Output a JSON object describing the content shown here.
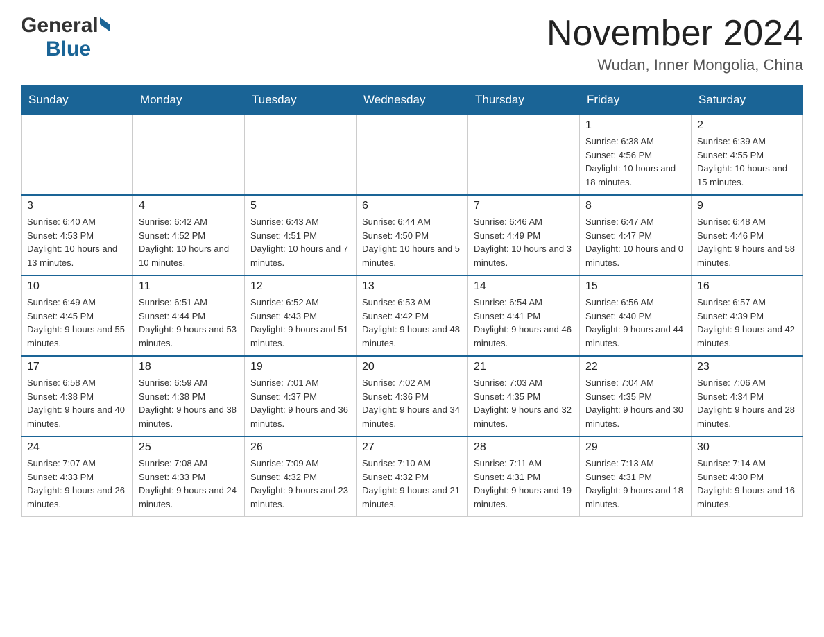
{
  "header": {
    "logo_general": "General",
    "logo_blue": "Blue",
    "month_title": "November 2024",
    "location": "Wudan, Inner Mongolia, China"
  },
  "weekdays": [
    "Sunday",
    "Monday",
    "Tuesday",
    "Wednesday",
    "Thursday",
    "Friday",
    "Saturday"
  ],
  "weeks": [
    [
      {
        "day": "",
        "info": ""
      },
      {
        "day": "",
        "info": ""
      },
      {
        "day": "",
        "info": ""
      },
      {
        "day": "",
        "info": ""
      },
      {
        "day": "",
        "info": ""
      },
      {
        "day": "1",
        "info": "Sunrise: 6:38 AM\nSunset: 4:56 PM\nDaylight: 10 hours and 18 minutes."
      },
      {
        "day": "2",
        "info": "Sunrise: 6:39 AM\nSunset: 4:55 PM\nDaylight: 10 hours and 15 minutes."
      }
    ],
    [
      {
        "day": "3",
        "info": "Sunrise: 6:40 AM\nSunset: 4:53 PM\nDaylight: 10 hours and 13 minutes."
      },
      {
        "day": "4",
        "info": "Sunrise: 6:42 AM\nSunset: 4:52 PM\nDaylight: 10 hours and 10 minutes."
      },
      {
        "day": "5",
        "info": "Sunrise: 6:43 AM\nSunset: 4:51 PM\nDaylight: 10 hours and 7 minutes."
      },
      {
        "day": "6",
        "info": "Sunrise: 6:44 AM\nSunset: 4:50 PM\nDaylight: 10 hours and 5 minutes."
      },
      {
        "day": "7",
        "info": "Sunrise: 6:46 AM\nSunset: 4:49 PM\nDaylight: 10 hours and 3 minutes."
      },
      {
        "day": "8",
        "info": "Sunrise: 6:47 AM\nSunset: 4:47 PM\nDaylight: 10 hours and 0 minutes."
      },
      {
        "day": "9",
        "info": "Sunrise: 6:48 AM\nSunset: 4:46 PM\nDaylight: 9 hours and 58 minutes."
      }
    ],
    [
      {
        "day": "10",
        "info": "Sunrise: 6:49 AM\nSunset: 4:45 PM\nDaylight: 9 hours and 55 minutes."
      },
      {
        "day": "11",
        "info": "Sunrise: 6:51 AM\nSunset: 4:44 PM\nDaylight: 9 hours and 53 minutes."
      },
      {
        "day": "12",
        "info": "Sunrise: 6:52 AM\nSunset: 4:43 PM\nDaylight: 9 hours and 51 minutes."
      },
      {
        "day": "13",
        "info": "Sunrise: 6:53 AM\nSunset: 4:42 PM\nDaylight: 9 hours and 48 minutes."
      },
      {
        "day": "14",
        "info": "Sunrise: 6:54 AM\nSunset: 4:41 PM\nDaylight: 9 hours and 46 minutes."
      },
      {
        "day": "15",
        "info": "Sunrise: 6:56 AM\nSunset: 4:40 PM\nDaylight: 9 hours and 44 minutes."
      },
      {
        "day": "16",
        "info": "Sunrise: 6:57 AM\nSunset: 4:39 PM\nDaylight: 9 hours and 42 minutes."
      }
    ],
    [
      {
        "day": "17",
        "info": "Sunrise: 6:58 AM\nSunset: 4:38 PM\nDaylight: 9 hours and 40 minutes."
      },
      {
        "day": "18",
        "info": "Sunrise: 6:59 AM\nSunset: 4:38 PM\nDaylight: 9 hours and 38 minutes."
      },
      {
        "day": "19",
        "info": "Sunrise: 7:01 AM\nSunset: 4:37 PM\nDaylight: 9 hours and 36 minutes."
      },
      {
        "day": "20",
        "info": "Sunrise: 7:02 AM\nSunset: 4:36 PM\nDaylight: 9 hours and 34 minutes."
      },
      {
        "day": "21",
        "info": "Sunrise: 7:03 AM\nSunset: 4:35 PM\nDaylight: 9 hours and 32 minutes."
      },
      {
        "day": "22",
        "info": "Sunrise: 7:04 AM\nSunset: 4:35 PM\nDaylight: 9 hours and 30 minutes."
      },
      {
        "day": "23",
        "info": "Sunrise: 7:06 AM\nSunset: 4:34 PM\nDaylight: 9 hours and 28 minutes."
      }
    ],
    [
      {
        "day": "24",
        "info": "Sunrise: 7:07 AM\nSunset: 4:33 PM\nDaylight: 9 hours and 26 minutes."
      },
      {
        "day": "25",
        "info": "Sunrise: 7:08 AM\nSunset: 4:33 PM\nDaylight: 9 hours and 24 minutes."
      },
      {
        "day": "26",
        "info": "Sunrise: 7:09 AM\nSunset: 4:32 PM\nDaylight: 9 hours and 23 minutes."
      },
      {
        "day": "27",
        "info": "Sunrise: 7:10 AM\nSunset: 4:32 PM\nDaylight: 9 hours and 21 minutes."
      },
      {
        "day": "28",
        "info": "Sunrise: 7:11 AM\nSunset: 4:31 PM\nDaylight: 9 hours and 19 minutes."
      },
      {
        "day": "29",
        "info": "Sunrise: 7:13 AM\nSunset: 4:31 PM\nDaylight: 9 hours and 18 minutes."
      },
      {
        "day": "30",
        "info": "Sunrise: 7:14 AM\nSunset: 4:30 PM\nDaylight: 9 hours and 16 minutes."
      }
    ]
  ]
}
